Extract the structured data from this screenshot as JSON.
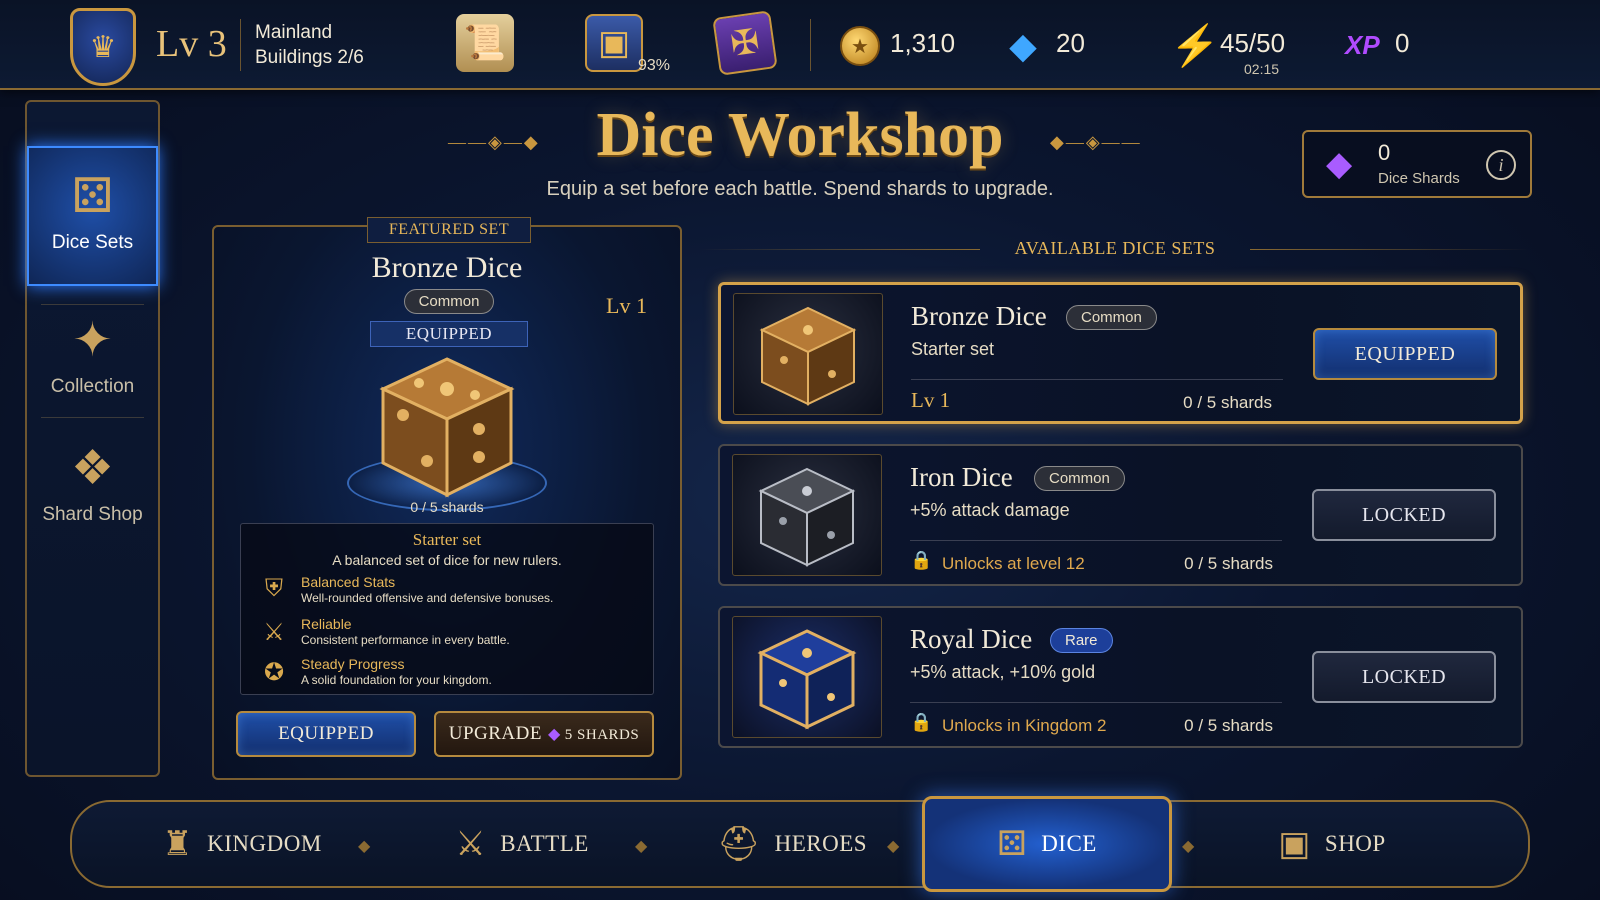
{
  "topbar": {
    "level": "Lv 3",
    "region": "Mainland",
    "buildings": "Buildings 2/6",
    "chest_pct": "93%",
    "gold": "1,310",
    "gems": "20",
    "energy": "45/50",
    "energy_timer": "02:15",
    "xp_label": "XP",
    "xp": "0",
    "icons": [
      "crest-icon",
      "scroll-icon",
      "chest-icon",
      "spellbook-icon",
      "gold-coin-icon",
      "gem-icon",
      "lightning-icon",
      "xp-icon"
    ]
  },
  "sidebar": {
    "items": [
      {
        "label": "Dice Sets",
        "icon": "dice-icon",
        "active": true
      },
      {
        "label": "Collection",
        "icon": "star-icon",
        "active": false
      },
      {
        "label": "Shard Shop",
        "icon": "crystal-icon",
        "active": false
      }
    ]
  },
  "header": {
    "title": "Dice Workshop",
    "subtitle": "Equip a set before each battle. Spend shards to upgrade.",
    "shards_count": "0",
    "shards_label": "Dice Shards",
    "info_glyph": "i"
  },
  "featured": {
    "badge": "FEATURED SET",
    "name": "Bronze Dice",
    "rarity": "Common",
    "level": "Lv 1",
    "status": "EQUIPPED",
    "shards": "0 / 5 shards",
    "info_title": "Starter set",
    "info_desc": "A balanced set of dice for new rulers.",
    "perks": [
      {
        "name": "Balanced Stats",
        "desc": "Well-rounded offensive and defensive bonuses.",
        "icon": "shield-icon"
      },
      {
        "name": "Reliable",
        "desc": "Consistent performance in every battle.",
        "icon": "crossed-swords-icon"
      },
      {
        "name": "Steady Progress",
        "desc": "A solid foundation for your kingdom.",
        "icon": "coin-icon"
      }
    ],
    "equipped_button": "EQUIPPED",
    "upgrade_button": "UPGRADE",
    "upgrade_cost": "5 SHARDS"
  },
  "available": {
    "heading": "AVAILABLE DICE SETS",
    "sets": [
      {
        "name": "Bronze Dice",
        "rarity": "Common",
        "desc": "Starter set",
        "footer": "Lv 1",
        "shards": "0 / 5 shards",
        "button": "EQUIPPED",
        "locked": false
      },
      {
        "name": "Iron Dice",
        "rarity": "Common",
        "desc": "+5% attack damage",
        "footer": "Unlocks at level 12",
        "shards": "0 / 5 shards",
        "button": "LOCKED",
        "locked": true
      },
      {
        "name": "Royal Dice",
        "rarity": "Rare",
        "desc": "+5% attack, +10% gold",
        "footer": "Unlocks in Kingdom 2",
        "shards": "0 / 5 shards",
        "button": "LOCKED",
        "locked": true
      }
    ]
  },
  "bottomnav": {
    "items": [
      {
        "label": "KINGDOM",
        "icon": "castle-icon",
        "active": false
      },
      {
        "label": "BATTLE",
        "icon": "crossed-swords-icon",
        "active": false
      },
      {
        "label": "HEROES",
        "icon": "helmet-icon",
        "active": false
      },
      {
        "label": "DICE",
        "icon": "dice-icon",
        "active": true
      },
      {
        "label": "SHOP",
        "icon": "treasure-chest-icon",
        "active": false
      }
    ]
  },
  "colors": {
    "gold_accent": "#e8b85a",
    "active_blue": "#1f4fa8",
    "background": "#0b1630",
    "rare_blue": "#1d3f9a"
  }
}
